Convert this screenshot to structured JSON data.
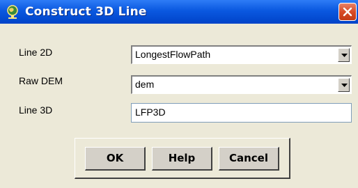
{
  "window": {
    "title": "Construct 3D Line",
    "icon": "globe-icon"
  },
  "form": {
    "line2d": {
      "label": "Line 2D",
      "value": "LongestFlowPath"
    },
    "raw_dem": {
      "label": "Raw DEM",
      "value": "dem"
    },
    "line3d": {
      "label": "Line 3D",
      "value": "LFP3D"
    }
  },
  "buttons": {
    "ok": "OK",
    "help": "Help",
    "cancel": "Cancel"
  },
  "colors": {
    "titlebar": "#0a58e0",
    "dialog_bg": "#ece9d8",
    "close": "#d84b27"
  }
}
